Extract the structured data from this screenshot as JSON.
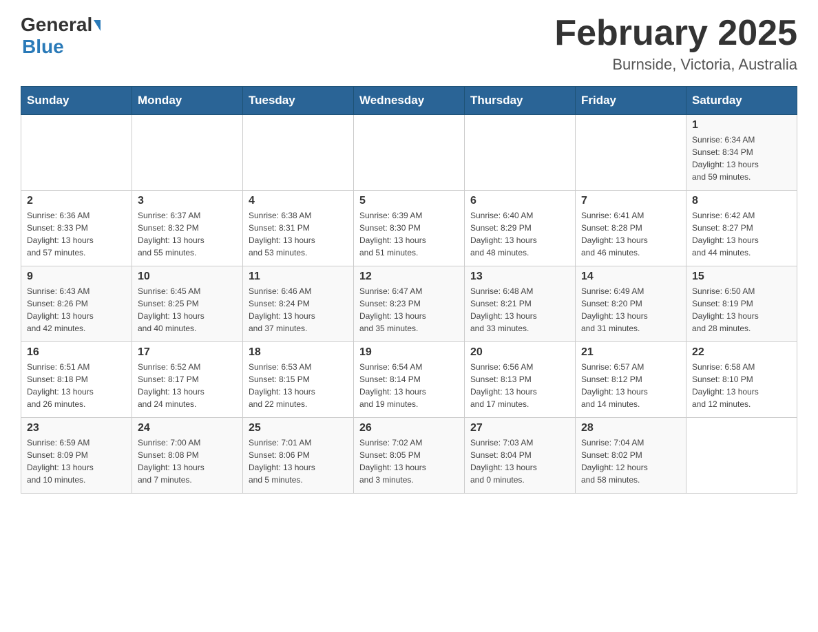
{
  "header": {
    "logo_general": "General",
    "logo_blue": "Blue",
    "month_title": "February 2025",
    "location": "Burnside, Victoria, Australia"
  },
  "weekdays": [
    "Sunday",
    "Monday",
    "Tuesday",
    "Wednesday",
    "Thursday",
    "Friday",
    "Saturday"
  ],
  "weeks": [
    [
      {
        "day": "",
        "info": ""
      },
      {
        "day": "",
        "info": ""
      },
      {
        "day": "",
        "info": ""
      },
      {
        "day": "",
        "info": ""
      },
      {
        "day": "",
        "info": ""
      },
      {
        "day": "",
        "info": ""
      },
      {
        "day": "1",
        "info": "Sunrise: 6:34 AM\nSunset: 8:34 PM\nDaylight: 13 hours\nand 59 minutes."
      }
    ],
    [
      {
        "day": "2",
        "info": "Sunrise: 6:36 AM\nSunset: 8:33 PM\nDaylight: 13 hours\nand 57 minutes."
      },
      {
        "day": "3",
        "info": "Sunrise: 6:37 AM\nSunset: 8:32 PM\nDaylight: 13 hours\nand 55 minutes."
      },
      {
        "day": "4",
        "info": "Sunrise: 6:38 AM\nSunset: 8:31 PM\nDaylight: 13 hours\nand 53 minutes."
      },
      {
        "day": "5",
        "info": "Sunrise: 6:39 AM\nSunset: 8:30 PM\nDaylight: 13 hours\nand 51 minutes."
      },
      {
        "day": "6",
        "info": "Sunrise: 6:40 AM\nSunset: 8:29 PM\nDaylight: 13 hours\nand 48 minutes."
      },
      {
        "day": "7",
        "info": "Sunrise: 6:41 AM\nSunset: 8:28 PM\nDaylight: 13 hours\nand 46 minutes."
      },
      {
        "day": "8",
        "info": "Sunrise: 6:42 AM\nSunset: 8:27 PM\nDaylight: 13 hours\nand 44 minutes."
      }
    ],
    [
      {
        "day": "9",
        "info": "Sunrise: 6:43 AM\nSunset: 8:26 PM\nDaylight: 13 hours\nand 42 minutes."
      },
      {
        "day": "10",
        "info": "Sunrise: 6:45 AM\nSunset: 8:25 PM\nDaylight: 13 hours\nand 40 minutes."
      },
      {
        "day": "11",
        "info": "Sunrise: 6:46 AM\nSunset: 8:24 PM\nDaylight: 13 hours\nand 37 minutes."
      },
      {
        "day": "12",
        "info": "Sunrise: 6:47 AM\nSunset: 8:23 PM\nDaylight: 13 hours\nand 35 minutes."
      },
      {
        "day": "13",
        "info": "Sunrise: 6:48 AM\nSunset: 8:21 PM\nDaylight: 13 hours\nand 33 minutes."
      },
      {
        "day": "14",
        "info": "Sunrise: 6:49 AM\nSunset: 8:20 PM\nDaylight: 13 hours\nand 31 minutes."
      },
      {
        "day": "15",
        "info": "Sunrise: 6:50 AM\nSunset: 8:19 PM\nDaylight: 13 hours\nand 28 minutes."
      }
    ],
    [
      {
        "day": "16",
        "info": "Sunrise: 6:51 AM\nSunset: 8:18 PM\nDaylight: 13 hours\nand 26 minutes."
      },
      {
        "day": "17",
        "info": "Sunrise: 6:52 AM\nSunset: 8:17 PM\nDaylight: 13 hours\nand 24 minutes."
      },
      {
        "day": "18",
        "info": "Sunrise: 6:53 AM\nSunset: 8:15 PM\nDaylight: 13 hours\nand 22 minutes."
      },
      {
        "day": "19",
        "info": "Sunrise: 6:54 AM\nSunset: 8:14 PM\nDaylight: 13 hours\nand 19 minutes."
      },
      {
        "day": "20",
        "info": "Sunrise: 6:56 AM\nSunset: 8:13 PM\nDaylight: 13 hours\nand 17 minutes."
      },
      {
        "day": "21",
        "info": "Sunrise: 6:57 AM\nSunset: 8:12 PM\nDaylight: 13 hours\nand 14 minutes."
      },
      {
        "day": "22",
        "info": "Sunrise: 6:58 AM\nSunset: 8:10 PM\nDaylight: 13 hours\nand 12 minutes."
      }
    ],
    [
      {
        "day": "23",
        "info": "Sunrise: 6:59 AM\nSunset: 8:09 PM\nDaylight: 13 hours\nand 10 minutes."
      },
      {
        "day": "24",
        "info": "Sunrise: 7:00 AM\nSunset: 8:08 PM\nDaylight: 13 hours\nand 7 minutes."
      },
      {
        "day": "25",
        "info": "Sunrise: 7:01 AM\nSunset: 8:06 PM\nDaylight: 13 hours\nand 5 minutes."
      },
      {
        "day": "26",
        "info": "Sunrise: 7:02 AM\nSunset: 8:05 PM\nDaylight: 13 hours\nand 3 minutes."
      },
      {
        "day": "27",
        "info": "Sunrise: 7:03 AM\nSunset: 8:04 PM\nDaylight: 13 hours\nand 0 minutes."
      },
      {
        "day": "28",
        "info": "Sunrise: 7:04 AM\nSunset: 8:02 PM\nDaylight: 12 hours\nand 58 minutes."
      },
      {
        "day": "",
        "info": ""
      }
    ]
  ]
}
